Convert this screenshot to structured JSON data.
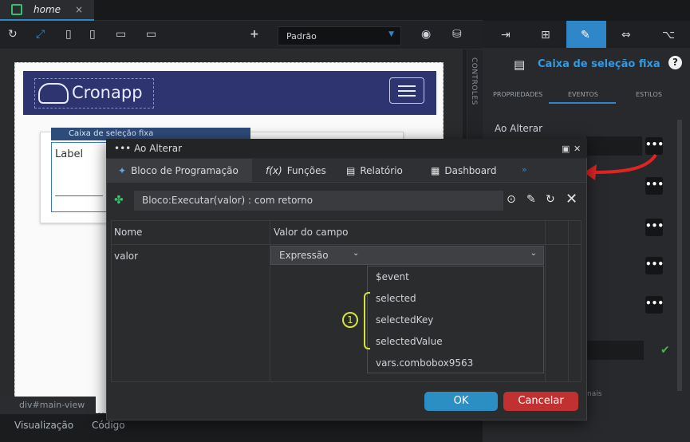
{
  "tab": {
    "title": "home",
    "close": "×"
  },
  "toolbar": {
    "device_select": "Padrão"
  },
  "canvas": {
    "logo": "Cronapp",
    "component_header": "Caixa de seleção fixa",
    "component_label": "Label"
  },
  "side_strip": {
    "label": "CONTROLES"
  },
  "bottom": {
    "crumb": "div#main-view",
    "tab_view": "Visualização",
    "tab_code": "Código"
  },
  "right_panel": {
    "title": "Caixa de seleção fixa",
    "help": "?",
    "tabs": [
      "PROPRIEDADES",
      "EVENTOS",
      "ESTILOS"
    ],
    "section_label": "Ao Alterar",
    "footer_fragment": "nais"
  },
  "modal": {
    "title": "Ao Alterar",
    "tabs": [
      {
        "label": "Bloco de Programação",
        "icon": "puzzle-icon"
      },
      {
        "label": "Funções",
        "icon": "function-icon"
      },
      {
        "label": "Relatório",
        "icon": "report-icon"
      },
      {
        "label": "Dashboard",
        "icon": "dashboard-icon"
      }
    ],
    "more": "»",
    "block_value": "Bloco:Executar(valor) : com retorno",
    "grid_headers": [
      "Nome",
      "Valor do campo"
    ],
    "row_name": "valor",
    "field_type": "Expressão",
    "dropdown": [
      "$event",
      "selected",
      "selectedKey",
      "selectedValue",
      "vars.combobox9563"
    ],
    "annotation_number": "1",
    "ok": "OK",
    "cancel": "Cancelar"
  },
  "colors": {
    "accent": "#2f87c9",
    "ok": "#2b8fc4",
    "cancel": "#c23131",
    "annotation": "#d6e43a",
    "arrow": "#e02424"
  }
}
